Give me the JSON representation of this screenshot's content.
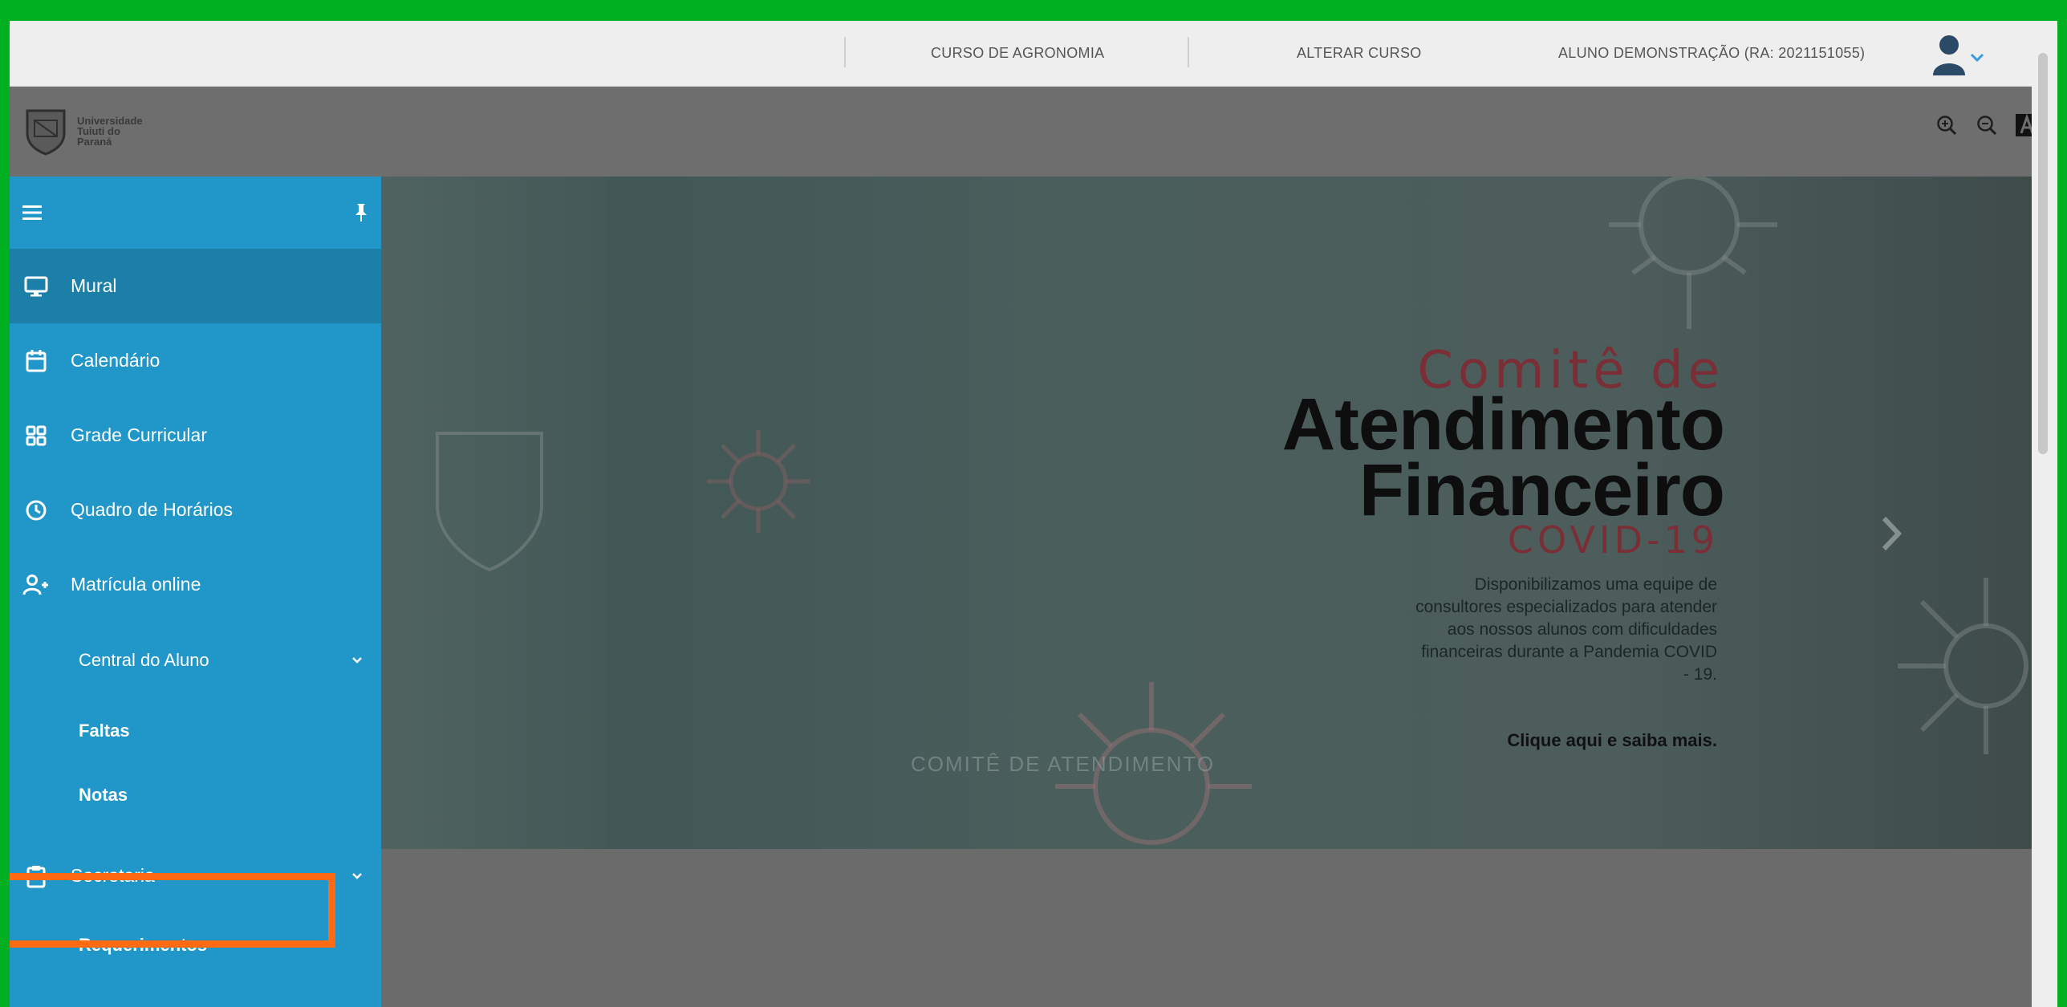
{
  "topbar": {
    "course": "CURSO DE AGRONOMIA",
    "change_course": "ALTERAR CURSO",
    "student": "ALUNO DEMONSTRAÇÃO (RA: 2021151055)"
  },
  "logo": {
    "line1": "Universidade",
    "line2": "Tuiuti do",
    "line3": "Paraná"
  },
  "sidebar": {
    "items": [
      {
        "label": "Mural",
        "icon": "monitor-icon",
        "active": true
      },
      {
        "label": "Calendário",
        "icon": "calendar-icon"
      },
      {
        "label": "Grade Curricular",
        "icon": "grid-icon"
      },
      {
        "label": "Quadro de Horários",
        "icon": "clock-icon"
      },
      {
        "label": "Matrícula online",
        "icon": "add-user-icon"
      }
    ],
    "central": {
      "label": "Central do Aluno",
      "subitems": [
        "Faltas",
        "Notas"
      ]
    },
    "secretaria": {
      "label": "Secretaria",
      "subitems": [
        "Requerimentos"
      ]
    }
  },
  "banner": {
    "title_line1": "Comitê de",
    "title_line2": "Atendimento",
    "title_line3": "Financeiro",
    "subtitle": "COVID-19",
    "description": "Disponibilizamos uma equipe de consultores especializados para atender aos nossos alunos com dificuldades financeiras durante a Pandemia COVID - 19.",
    "link": "Clique aqui e saiba mais.",
    "ghost_text": "COMITÊ DE ATENDIMENTO"
  },
  "colors": {
    "frame": "#00b020",
    "sidebar": "#2196c8",
    "sidebar_active": "#1c7fa8",
    "highlight": "#ff6a13",
    "accent_red": "#7a2e36"
  }
}
